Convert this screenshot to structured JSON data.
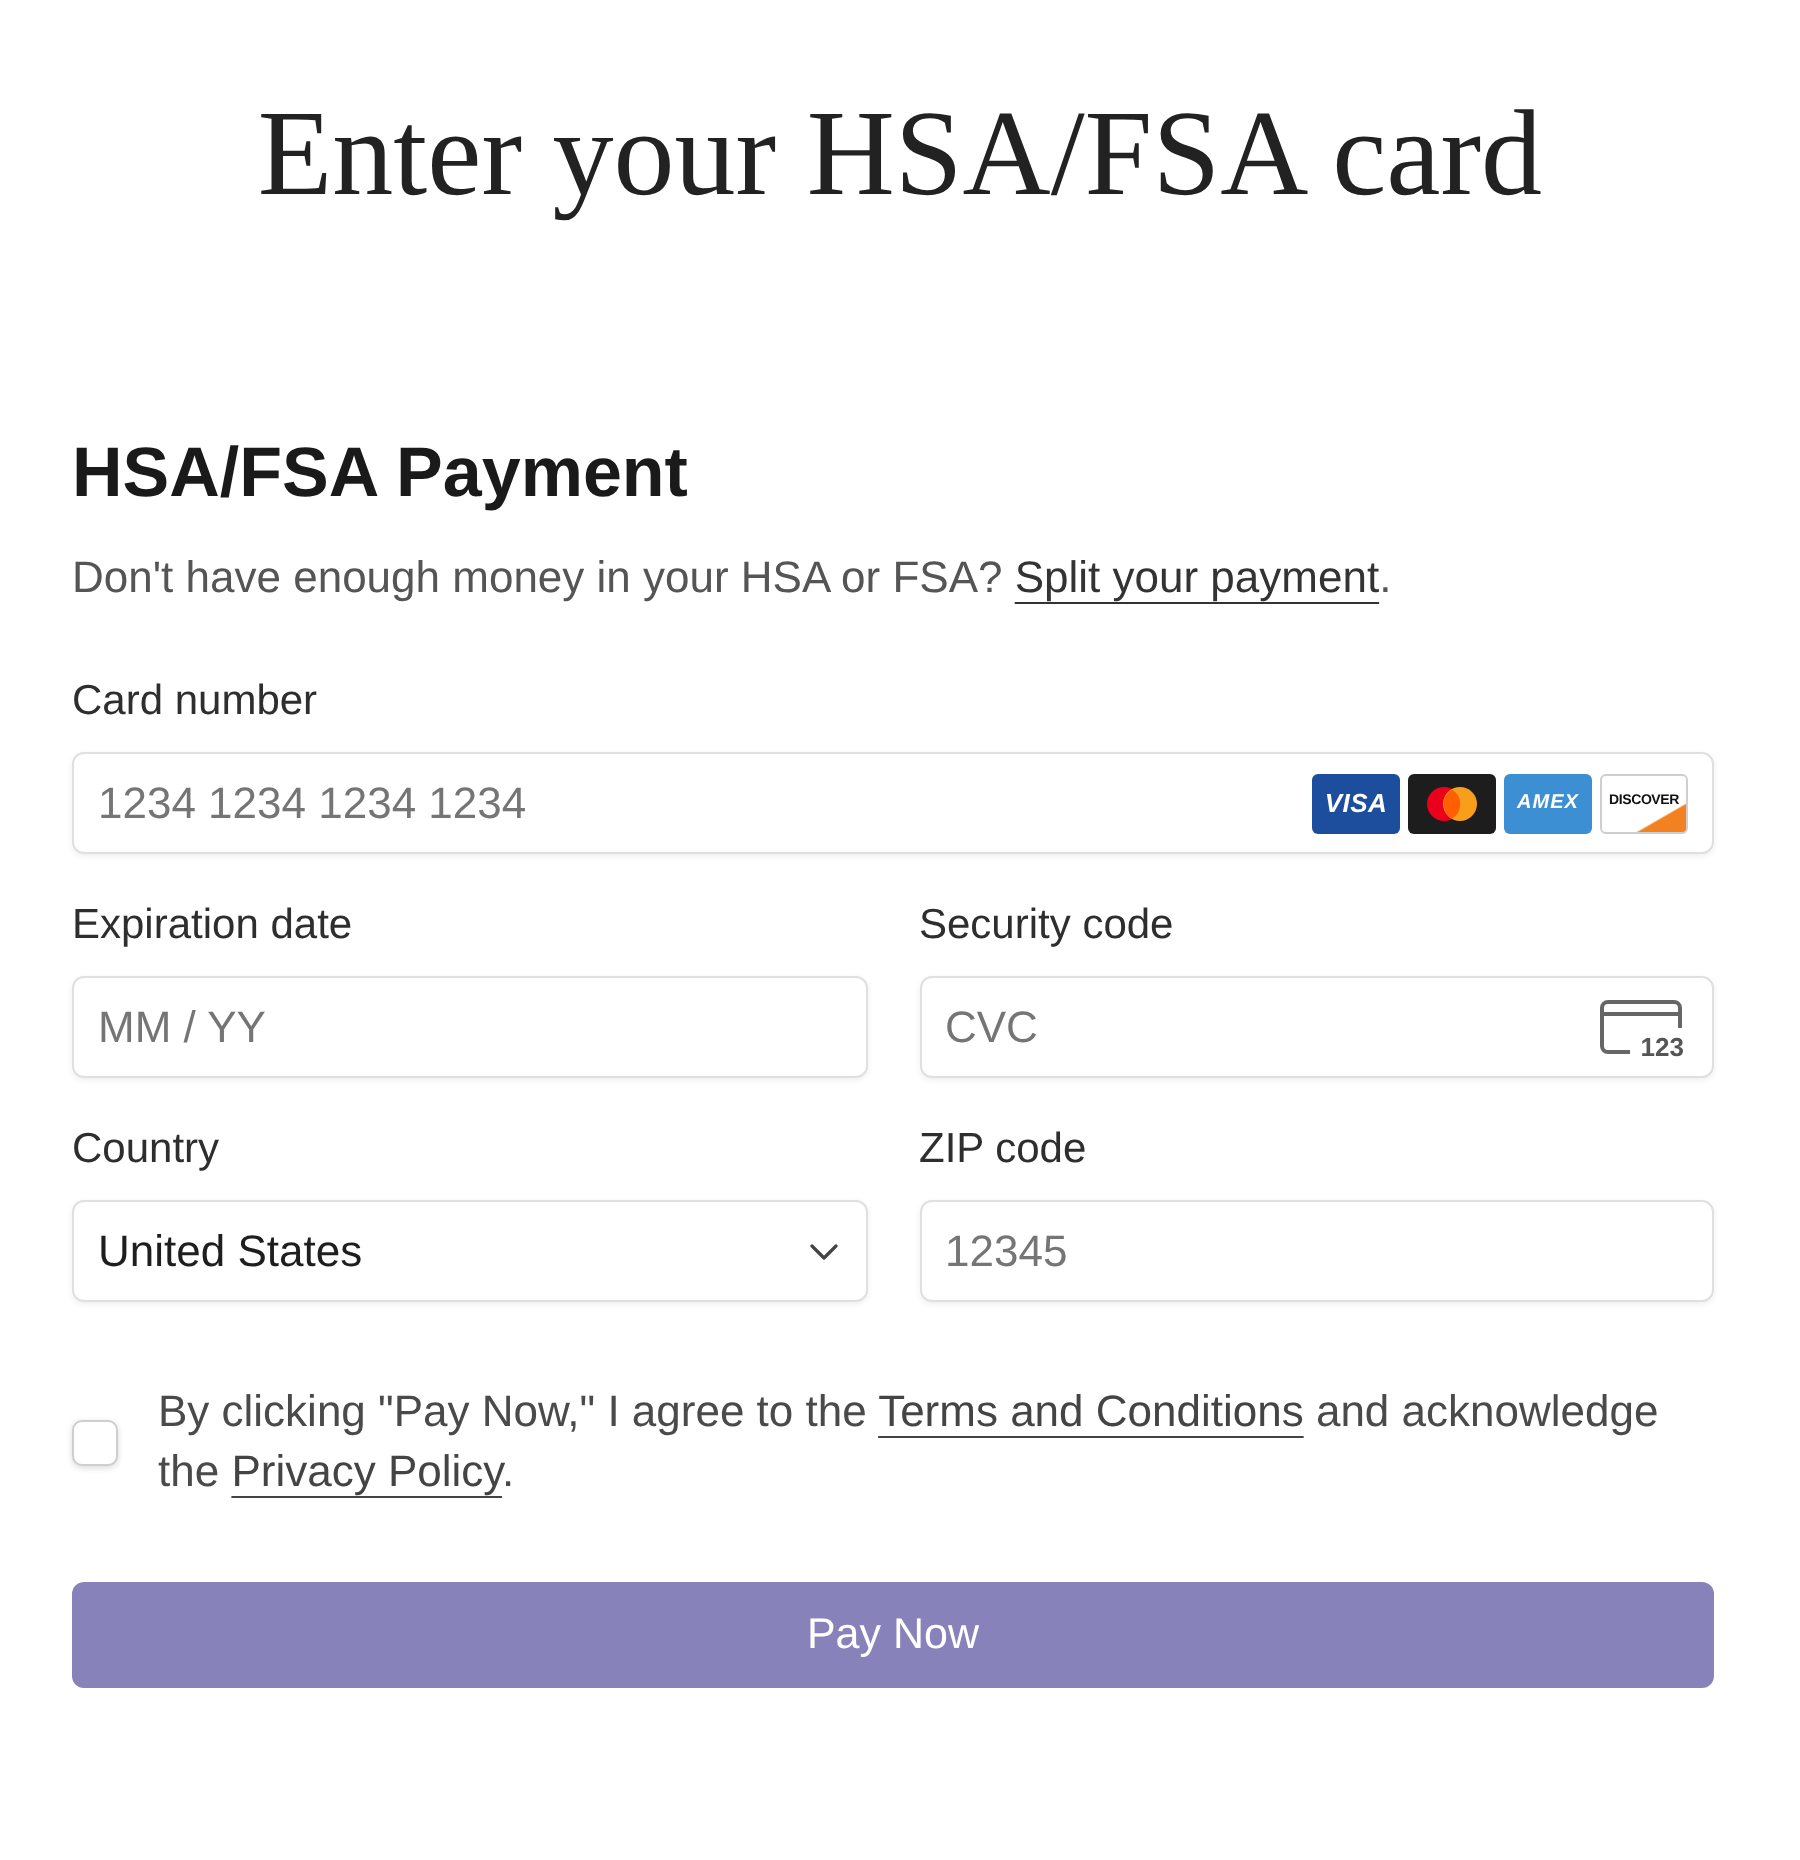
{
  "page_title": "Enter your HSA/FSA card",
  "form": {
    "heading": "HSA/FSA Payment",
    "intro": [
      {
        "kind": "text",
        "text": "Don't have enough money in your HSA or FSA? "
      },
      {
        "kind": "link",
        "text": "Split your payment"
      },
      {
        "kind": "text",
        "text": "."
      }
    ],
    "rows": [
      {
        "fields": [
          {
            "kind": "input",
            "label": "Card number",
            "placeholder": "1234 1234 1234 1234",
            "brands": [
              {
                "kind": "visa",
                "label": "VISA"
              },
              {
                "kind": "mastercard"
              },
              {
                "kind": "amex",
                "label": "AMEX"
              },
              {
                "kind": "discover",
                "label": "DISCOVER"
              }
            ]
          }
        ]
      },
      {
        "fields": [
          {
            "kind": "input",
            "label": "Expiration date",
            "placeholder": "MM / YY"
          },
          {
            "kind": "input",
            "label": "Security code",
            "placeholder": "CVC",
            "code_icon": "123"
          }
        ]
      },
      {
        "fields": [
          {
            "kind": "select",
            "label": "Country",
            "value": "United States"
          },
          {
            "kind": "input",
            "label": "ZIP code",
            "placeholder": "12345"
          }
        ]
      }
    ],
    "consent": {
      "checked": false,
      "parts": [
        {
          "kind": "text",
          "text": "By clicking \"Pay Now,\" I agree to the "
        },
        {
          "kind": "link",
          "text": "Terms and Conditions"
        },
        {
          "kind": "text",
          "text": " and acknowledge the "
        },
        {
          "kind": "link",
          "text": "Privacy Policy"
        },
        {
          "kind": "text",
          "text": "."
        }
      ]
    },
    "button": {
      "label": "Pay Now",
      "disabled": true
    }
  }
}
